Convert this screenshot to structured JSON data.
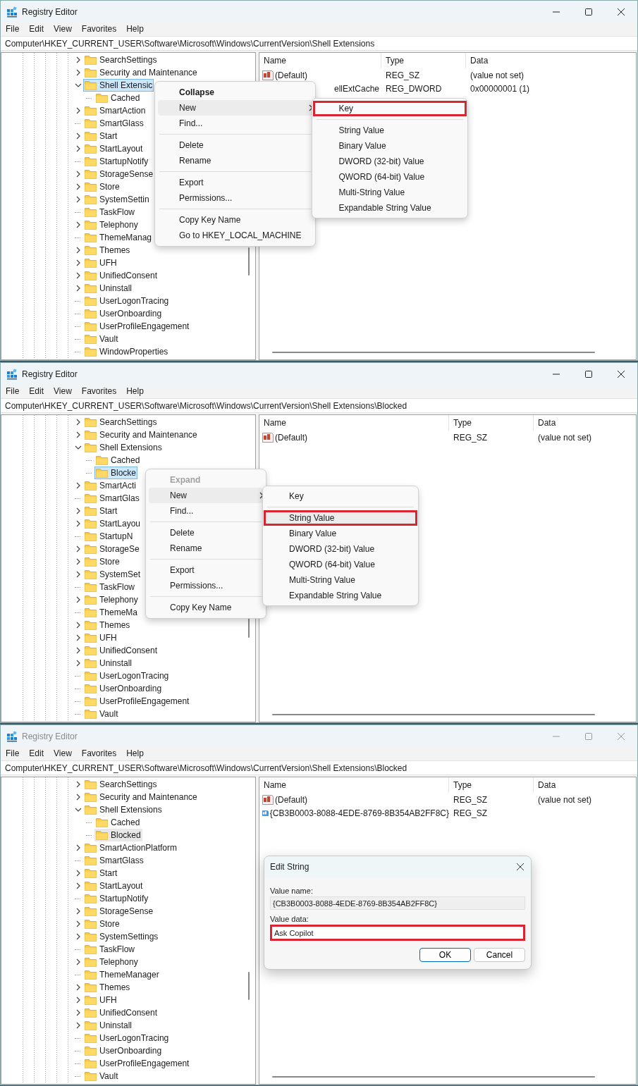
{
  "windows": [
    {
      "title": "Registry Editor",
      "active": true,
      "menu": [
        "File",
        "Edit",
        "View",
        "Favorites",
        "Help"
      ],
      "address": "Computer\\HKEY_CURRENT_USER\\Software\\Microsoft\\Windows\\CurrentVersion\\Shell Extensions",
      "tree": [
        {
          "label": "SearchSettings",
          "expandable": true,
          "expanded": false,
          "selected": false
        },
        {
          "label": "Security and Maintenance",
          "expandable": true,
          "expanded": false,
          "selected": false
        },
        {
          "label": "Shell Extensic",
          "expandable": true,
          "expanded": true,
          "selected": true,
          "children": [
            {
              "label": "Cached",
              "expandable": false,
              "selected": false
            }
          ]
        },
        {
          "label": "SmartAction",
          "expandable": true,
          "expanded": false,
          "selected": false
        },
        {
          "label": "SmartGlass",
          "expandable": false,
          "selected": false
        },
        {
          "label": "Start",
          "expandable": true,
          "expanded": false,
          "selected": false
        },
        {
          "label": "StartLayout",
          "expandable": true,
          "expanded": false,
          "selected": false
        },
        {
          "label": "StartupNotify",
          "expandable": false,
          "selected": false
        },
        {
          "label": "StorageSense",
          "expandable": true,
          "expanded": false,
          "selected": false
        },
        {
          "label": "Store",
          "expandable": true,
          "expanded": false,
          "selected": false
        },
        {
          "label": "SystemSettin",
          "expandable": true,
          "expanded": false,
          "selected": false
        },
        {
          "label": "TaskFlow",
          "expandable": false,
          "selected": false
        },
        {
          "label": "Telephony",
          "expandable": true,
          "expanded": false,
          "selected": false
        },
        {
          "label": "ThemeManag",
          "expandable": false,
          "selected": false
        },
        {
          "label": "Themes",
          "expandable": true,
          "expanded": false,
          "selected": false
        },
        {
          "label": "UFH",
          "expandable": true,
          "expanded": false,
          "selected": false
        },
        {
          "label": "UnifiedConsent",
          "expandable": true,
          "expanded": false,
          "selected": false
        },
        {
          "label": "Uninstall",
          "expandable": true,
          "expanded": false,
          "selected": false
        },
        {
          "label": "UserLogonTracing",
          "expandable": false,
          "selected": false
        },
        {
          "label": "UserOnboarding",
          "expandable": false,
          "selected": false
        },
        {
          "label": "UserProfileEngagement",
          "expandable": false,
          "selected": false
        },
        {
          "label": "Vault",
          "expandable": false,
          "selected": false
        },
        {
          "label": "WindowProperties",
          "expandable": false,
          "selected": false
        }
      ],
      "columns": [
        "Name",
        "Type",
        "Data"
      ],
      "rows": [
        {
          "name": "(Default)",
          "type": "REG_SZ",
          "data": "(value not set)",
          "kind": "value"
        },
        {
          "name": "ellExtCache",
          "type": "REG_DWORD",
          "data": "0x00000001 (1)",
          "kind": "covered"
        }
      ],
      "context_menu": {
        "items": [
          {
            "kind": "item",
            "label": "Collapse",
            "bold": true,
            "disabled": false,
            "selected": false,
            "submenu": false
          },
          {
            "kind": "item",
            "label": "New",
            "bold": false,
            "disabled": false,
            "selected": true,
            "submenu": true
          },
          {
            "kind": "item",
            "label": "Find...",
            "bold": false,
            "disabled": false,
            "selected": false,
            "submenu": false
          },
          {
            "kind": "separator"
          },
          {
            "kind": "item",
            "label": "Delete",
            "bold": false,
            "disabled": false,
            "selected": false,
            "submenu": false
          },
          {
            "kind": "item",
            "label": "Rename",
            "bold": false,
            "disabled": false,
            "selected": false,
            "submenu": false
          },
          {
            "kind": "separator"
          },
          {
            "kind": "item",
            "label": "Export",
            "bold": false,
            "disabled": false,
            "selected": false,
            "submenu": false
          },
          {
            "kind": "item",
            "label": "Permissions...",
            "bold": false,
            "disabled": false,
            "selected": false,
            "submenu": false
          },
          {
            "kind": "separator"
          },
          {
            "kind": "item",
            "label": "Copy Key Name",
            "bold": false,
            "disabled": false,
            "selected": false,
            "submenu": false
          },
          {
            "kind": "item",
            "label": "Go to HKEY_LOCAL_MACHINE",
            "bold": false,
            "disabled": false,
            "selected": false,
            "submenu": false
          }
        ],
        "submenu": [
          {
            "kind": "item",
            "label": "Key",
            "selected": false,
            "annotated": true
          },
          {
            "kind": "separator"
          },
          {
            "kind": "item",
            "label": "String Value",
            "selected": false,
            "annotated": false
          },
          {
            "kind": "item",
            "label": "Binary Value",
            "selected": false,
            "annotated": false
          },
          {
            "kind": "item",
            "label": "DWORD (32-bit) Value",
            "selected": false,
            "annotated": false
          },
          {
            "kind": "item",
            "label": "QWORD (64-bit) Value",
            "selected": false,
            "annotated": false
          },
          {
            "kind": "item",
            "label": "Multi-String Value",
            "selected": false,
            "annotated": false
          },
          {
            "kind": "item",
            "label": "Expandable String Value",
            "selected": false,
            "annotated": false
          }
        ]
      }
    },
    {
      "title": "Registry Editor",
      "active": true,
      "menu": [
        "File",
        "Edit",
        "View",
        "Favorites",
        "Help"
      ],
      "address": "Computer\\HKEY_CURRENT_USER\\Software\\Microsoft\\Windows\\CurrentVersion\\Shell Extensions\\Blocked",
      "tree": [
        {
          "label": "SearchSettings",
          "expandable": true,
          "expanded": false,
          "selected": false
        },
        {
          "label": "Security and Maintenance",
          "expandable": true,
          "expanded": false,
          "selected": false
        },
        {
          "label": "Shell Extensions",
          "expandable": true,
          "expanded": true,
          "selected": false,
          "children": [
            {
              "label": "Cached",
              "expandable": false,
              "selected": false
            },
            {
              "label": "Blocke",
              "expandable": false,
              "selected": true
            }
          ]
        },
        {
          "label": "SmartActi",
          "expandable": true,
          "expanded": false,
          "selected": false
        },
        {
          "label": "SmartGlas",
          "expandable": false,
          "selected": false
        },
        {
          "label": "Start",
          "expandable": true,
          "expanded": false,
          "selected": false
        },
        {
          "label": "StartLayou",
          "expandable": true,
          "expanded": false,
          "selected": false
        },
        {
          "label": "StartupN",
          "expandable": false,
          "selected": false
        },
        {
          "label": "StorageSe",
          "expandable": true,
          "expanded": false,
          "selected": false
        },
        {
          "label": "Store",
          "expandable": true,
          "expanded": false,
          "selected": false
        },
        {
          "label": "SystemSet",
          "expandable": true,
          "expanded": false,
          "selected": false
        },
        {
          "label": "TaskFlow",
          "expandable": false,
          "selected": false
        },
        {
          "label": "Telephony",
          "expandable": true,
          "expanded": false,
          "selected": false
        },
        {
          "label": "ThemeMa",
          "expandable": false,
          "selected": false
        },
        {
          "label": "Themes",
          "expandable": true,
          "expanded": false,
          "selected": false
        },
        {
          "label": "UFH",
          "expandable": true,
          "expanded": false,
          "selected": false
        },
        {
          "label": "UnifiedConsent",
          "expandable": true,
          "expanded": false,
          "selected": false
        },
        {
          "label": "Uninstall",
          "expandable": true,
          "expanded": false,
          "selected": false
        },
        {
          "label": "UserLogonTracing",
          "expandable": false,
          "selected": false
        },
        {
          "label": "UserOnboarding",
          "expandable": false,
          "selected": false
        },
        {
          "label": "UserProfileEngagement",
          "expandable": false,
          "selected": false
        },
        {
          "label": "Vault",
          "expandable": false,
          "selected": false
        }
      ],
      "columns": [
        "Name",
        "Type",
        "Data"
      ],
      "rows": [
        {
          "name": "(Default)",
          "type": "REG_SZ",
          "data": "(value not set)",
          "kind": "value"
        }
      ],
      "context_menu": {
        "items": [
          {
            "kind": "item",
            "label": "Expand",
            "bold": true,
            "disabled": true,
            "selected": false,
            "submenu": false
          },
          {
            "kind": "item",
            "label": "New",
            "bold": false,
            "disabled": false,
            "selected": true,
            "submenu": true
          },
          {
            "kind": "item",
            "label": "Find...",
            "bold": false,
            "disabled": false,
            "selected": false,
            "submenu": false
          },
          {
            "kind": "separator"
          },
          {
            "kind": "item",
            "label": "Delete",
            "bold": false,
            "disabled": false,
            "selected": false,
            "submenu": false
          },
          {
            "kind": "item",
            "label": "Rename",
            "bold": false,
            "disabled": false,
            "selected": false,
            "submenu": false
          },
          {
            "kind": "separator"
          },
          {
            "kind": "item",
            "label": "Export",
            "bold": false,
            "disabled": false,
            "selected": false,
            "submenu": false
          },
          {
            "kind": "item",
            "label": "Permissions...",
            "bold": false,
            "disabled": false,
            "selected": false,
            "submenu": false
          },
          {
            "kind": "separator"
          },
          {
            "kind": "item",
            "label": "Copy Key Name",
            "bold": false,
            "disabled": false,
            "selected": false,
            "submenu": false
          }
        ],
        "submenu": [
          {
            "kind": "item",
            "label": "Key",
            "selected": false,
            "annotated": false
          },
          {
            "kind": "separator"
          },
          {
            "kind": "item",
            "label": "String Value",
            "selected": true,
            "annotated": true
          },
          {
            "kind": "item",
            "label": "Binary Value",
            "selected": false,
            "annotated": false
          },
          {
            "kind": "item",
            "label": "DWORD (32-bit) Value",
            "selected": false,
            "annotated": false
          },
          {
            "kind": "item",
            "label": "QWORD (64-bit) Value",
            "selected": false,
            "annotated": false
          },
          {
            "kind": "item",
            "label": "Multi-String Value",
            "selected": false,
            "annotated": false
          },
          {
            "kind": "item",
            "label": "Expandable String Value",
            "selected": false,
            "annotated": false
          }
        ]
      }
    },
    {
      "title": "Registry Editor",
      "active": false,
      "menu": [
        "File",
        "Edit",
        "View",
        "Favorites",
        "Help"
      ],
      "address": "Computer\\HKEY_CURRENT_USER\\Software\\Microsoft\\Windows\\CurrentVersion\\Shell Extensions\\Blocked",
      "tree": [
        {
          "label": "SearchSettings",
          "expandable": true,
          "expanded": false,
          "selected": false
        },
        {
          "label": "Security and Maintenance",
          "expandable": true,
          "expanded": false,
          "selected": false
        },
        {
          "label": "Shell Extensions",
          "expandable": true,
          "expanded": true,
          "selected": false,
          "children": [
            {
              "label": "Cached",
              "expandable": false,
              "selected": false
            },
            {
              "label": "Blocked",
              "expandable": false,
              "selected": true
            }
          ]
        },
        {
          "label": "SmartActionPlatform",
          "expandable": true,
          "expanded": false,
          "selected": false
        },
        {
          "label": "SmartGlass",
          "expandable": false,
          "selected": false
        },
        {
          "label": "Start",
          "expandable": true,
          "expanded": false,
          "selected": false
        },
        {
          "label": "StartLayout",
          "expandable": true,
          "expanded": false,
          "selected": false
        },
        {
          "label": "StartupNotify",
          "expandable": false,
          "selected": false
        },
        {
          "label": "StorageSense",
          "expandable": true,
          "expanded": false,
          "selected": false
        },
        {
          "label": "Store",
          "expandable": true,
          "expanded": false,
          "selected": false
        },
        {
          "label": "SystemSettings",
          "expandable": true,
          "expanded": false,
          "selected": false
        },
        {
          "label": "TaskFlow",
          "expandable": false,
          "selected": false
        },
        {
          "label": "Telephony",
          "expandable": true,
          "expanded": false,
          "selected": false
        },
        {
          "label": "ThemeManager",
          "expandable": false,
          "selected": false
        },
        {
          "label": "Themes",
          "expandable": true,
          "expanded": false,
          "selected": false
        },
        {
          "label": "UFH",
          "expandable": true,
          "expanded": false,
          "selected": false
        },
        {
          "label": "UnifiedConsent",
          "expandable": true,
          "expanded": false,
          "selected": false
        },
        {
          "label": "Uninstall",
          "expandable": true,
          "expanded": false,
          "selected": false
        },
        {
          "label": "UserLogonTracing",
          "expandable": false,
          "selected": false
        },
        {
          "label": "UserOnboarding",
          "expandable": false,
          "selected": false
        },
        {
          "label": "UserProfileEngagement",
          "expandable": false,
          "selected": false
        },
        {
          "label": "Vault",
          "expandable": false,
          "selected": false
        }
      ],
      "columns": [
        "Name",
        "Type",
        "Data"
      ],
      "rows": [
        {
          "name": "(Default)",
          "type": "REG_SZ",
          "data": "(value not set)",
          "kind": "value"
        },
        {
          "name": "{CB3B0003-8088-4EDE-8769-8B354AB2FF8C}",
          "type": "REG_SZ",
          "kind": "highlighted"
        }
      ],
      "dialog": {
        "title": "Edit String",
        "fields": [
          {
            "label": "Value name:",
            "value": "{CB3B0003-8088-4EDE-8769-8B354AB2FF8C}",
            "readonly": true,
            "annotated": false
          },
          {
            "label": "Value data:",
            "value": "Ask Copilot",
            "readonly": false,
            "annotated": true
          }
        ],
        "buttons": [
          {
            "label": "OK",
            "default": true
          },
          {
            "label": "Cancel",
            "default": false
          }
        ]
      }
    }
  ]
}
